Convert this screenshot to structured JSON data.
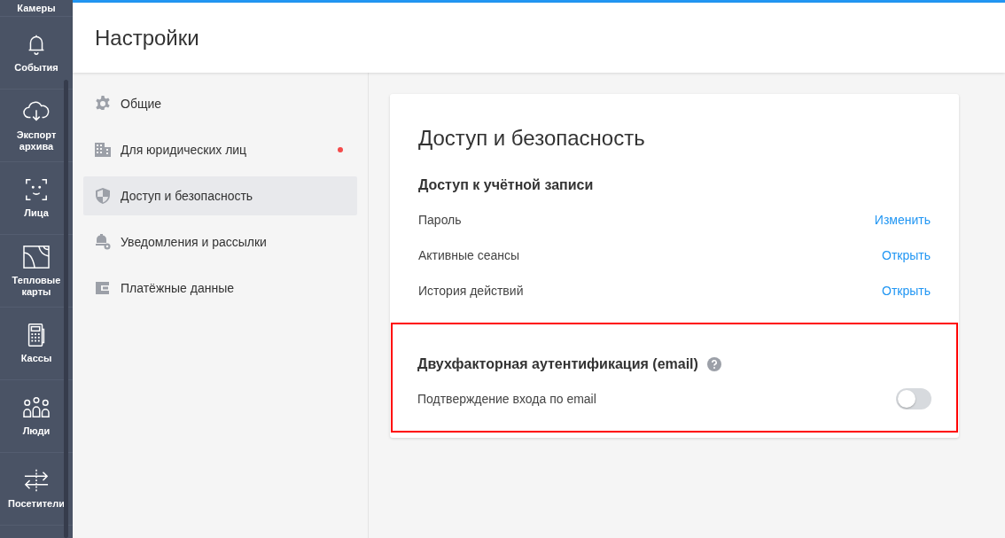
{
  "nav": [
    {
      "label": "Камеры",
      "kind": "camera"
    },
    {
      "label": "События",
      "kind": "bell"
    },
    {
      "label": "Экспорт архива",
      "kind": "cloud"
    },
    {
      "label": "Лица",
      "kind": "face"
    },
    {
      "label": "Тепловые карты",
      "kind": "heatmap"
    },
    {
      "label": "Кассы",
      "kind": "register"
    },
    {
      "label": "Люди",
      "kind": "people"
    },
    {
      "label": "Посетители",
      "kind": "arrows"
    }
  ],
  "header": {
    "title": "Настройки"
  },
  "menu": [
    {
      "label": "Общие",
      "kind": "gear",
      "selected": false,
      "dot": false
    },
    {
      "label": "Для юридических лиц",
      "kind": "building",
      "selected": false,
      "dot": true
    },
    {
      "label": "Доступ и безопасность",
      "kind": "shield",
      "selected": true,
      "dot": false
    },
    {
      "label": "Уведомления и рассылки",
      "kind": "bell-gear",
      "selected": false,
      "dot": false
    },
    {
      "label": "Платёжные данные",
      "kind": "wallet",
      "selected": false,
      "dot": false
    }
  ],
  "card": {
    "title": "Доступ и безопасность",
    "account": {
      "heading": "Доступ к учётной записи",
      "rows": [
        {
          "label": "Пароль",
          "action": "Изменить"
        },
        {
          "label": "Активные сеансы",
          "action": "Открыть"
        },
        {
          "label": "История действий",
          "action": "Открыть"
        }
      ]
    },
    "two_factor": {
      "heading": "Двухфакторная аутентификация (email)",
      "highlighted": true,
      "row": {
        "label": "Подтверждение входа по email",
        "on": false
      }
    }
  }
}
